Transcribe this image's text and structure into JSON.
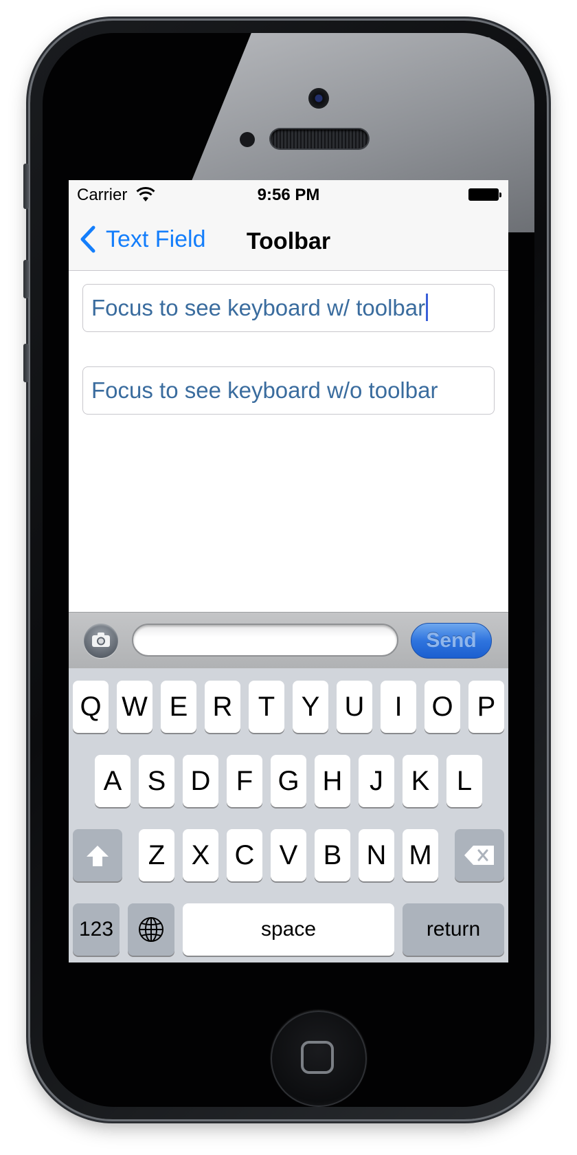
{
  "status_bar": {
    "carrier": "Carrier",
    "time": "9:56 PM"
  },
  "nav_bar": {
    "back_label": "Text Field",
    "title": "Toolbar"
  },
  "fields": [
    {
      "value": "Focus to see keyboard w/ toolbar",
      "focused": true
    },
    {
      "value": "Focus to see keyboard w/o toolbar",
      "focused": false
    }
  ],
  "message_toolbar": {
    "input_value": "",
    "send_label": "Send"
  },
  "keyboard": {
    "row1": [
      "Q",
      "W",
      "E",
      "R",
      "T",
      "Y",
      "U",
      "I",
      "O",
      "P"
    ],
    "row2": [
      "A",
      "S",
      "D",
      "F",
      "G",
      "H",
      "J",
      "K",
      "L"
    ],
    "row3": [
      "Z",
      "X",
      "C",
      "V",
      "B",
      "N",
      "M"
    ],
    "numbers_label": "123",
    "space_label": "space",
    "return_label": "return"
  },
  "colors": {
    "tint": "#147efb",
    "field_text": "#3a6c9e",
    "keyboard_bg": "#d1d5db",
    "send_button": "#2f74de"
  },
  "icons": {
    "back": "chevron-left-icon",
    "camera": "camera-icon",
    "shift": "shift-arrow-icon",
    "delete": "delete-backspace-icon",
    "globe": "globe-icon",
    "wifi": "wifi-icon",
    "battery": "battery-icon"
  }
}
